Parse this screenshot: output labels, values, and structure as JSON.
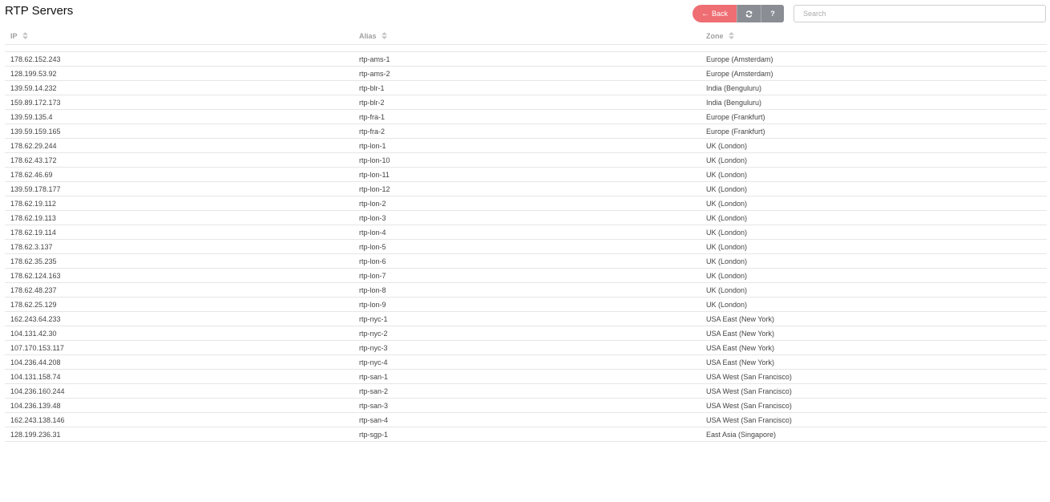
{
  "page": {
    "title": "RTP Servers"
  },
  "toolbar": {
    "back_label": "Back",
    "back_icon": "arrow-left-icon",
    "refresh_icon": "refresh-icon",
    "help_label": "?",
    "back_color": "#ee6e73",
    "secondary_color": "#8a8d93"
  },
  "search": {
    "placeholder": "Search",
    "value": ""
  },
  "table": {
    "columns": [
      {
        "label": "IP"
      },
      {
        "label": "Alias"
      },
      {
        "label": "Zone"
      }
    ],
    "rows": [
      {
        "ip": "178.62.152.243",
        "alias": "rtp-ams-1",
        "zone": "Europe (Amsterdam)"
      },
      {
        "ip": "128.199.53.92",
        "alias": "rtp-ams-2",
        "zone": "Europe (Amsterdam)"
      },
      {
        "ip": "139.59.14.232",
        "alias": "rtp-blr-1",
        "zone": "India (Benguluru)"
      },
      {
        "ip": "159.89.172.173",
        "alias": "rtp-blr-2",
        "zone": "India (Benguluru)"
      },
      {
        "ip": "139.59.135.4",
        "alias": "rtp-fra-1",
        "zone": "Europe (Frankfurt)"
      },
      {
        "ip": "139.59.159.165",
        "alias": "rtp-fra-2",
        "zone": "Europe (Frankfurt)"
      },
      {
        "ip": "178.62.29.244",
        "alias": "rtp-lon-1",
        "zone": "UK (London)"
      },
      {
        "ip": "178.62.43.172",
        "alias": "rtp-lon-10",
        "zone": "UK (London)"
      },
      {
        "ip": "178.62.46.69",
        "alias": "rtp-lon-11",
        "zone": "UK (London)"
      },
      {
        "ip": "139.59.178.177",
        "alias": "rtp-lon-12",
        "zone": "UK (London)"
      },
      {
        "ip": "178.62.19.112",
        "alias": "rtp-lon-2",
        "zone": "UK (London)"
      },
      {
        "ip": "178.62.19.113",
        "alias": "rtp-lon-3",
        "zone": "UK (London)"
      },
      {
        "ip": "178.62.19.114",
        "alias": "rtp-lon-4",
        "zone": "UK (London)"
      },
      {
        "ip": "178.62.3.137",
        "alias": "rtp-lon-5",
        "zone": "UK (London)"
      },
      {
        "ip": "178.62.35.235",
        "alias": "rtp-lon-6",
        "zone": "UK (London)"
      },
      {
        "ip": "178.62.124.163",
        "alias": "rtp-lon-7",
        "zone": "UK (London)"
      },
      {
        "ip": "178.62.48.237",
        "alias": "rtp-lon-8",
        "zone": "UK (London)"
      },
      {
        "ip": "178.62.25.129",
        "alias": "rtp-lon-9",
        "zone": "UK (London)"
      },
      {
        "ip": "162.243.64.233",
        "alias": "rtp-nyc-1",
        "zone": "USA East (New York)"
      },
      {
        "ip": "104.131.42.30",
        "alias": "rtp-nyc-2",
        "zone": "USA East (New York)"
      },
      {
        "ip": "107.170.153.117",
        "alias": "rtp-nyc-3",
        "zone": "USA East (New York)"
      },
      {
        "ip": "104.236.44.208",
        "alias": "rtp-nyc-4",
        "zone": "USA East (New York)"
      },
      {
        "ip": "104.131.158.74",
        "alias": "rtp-san-1",
        "zone": "USA West (San Francisco)"
      },
      {
        "ip": "104.236.160.244",
        "alias": "rtp-san-2",
        "zone": "USA West (San Francisco)"
      },
      {
        "ip": "104.236.139.48",
        "alias": "rtp-san-3",
        "zone": "USA West (San Francisco)"
      },
      {
        "ip": "162.243.138.146",
        "alias": "rtp-san-4",
        "zone": "USA West (San Francisco)"
      },
      {
        "ip": "128.199.236.31",
        "alias": "rtp-sgp-1",
        "zone": "East Asia (Singapore)"
      }
    ]
  }
}
